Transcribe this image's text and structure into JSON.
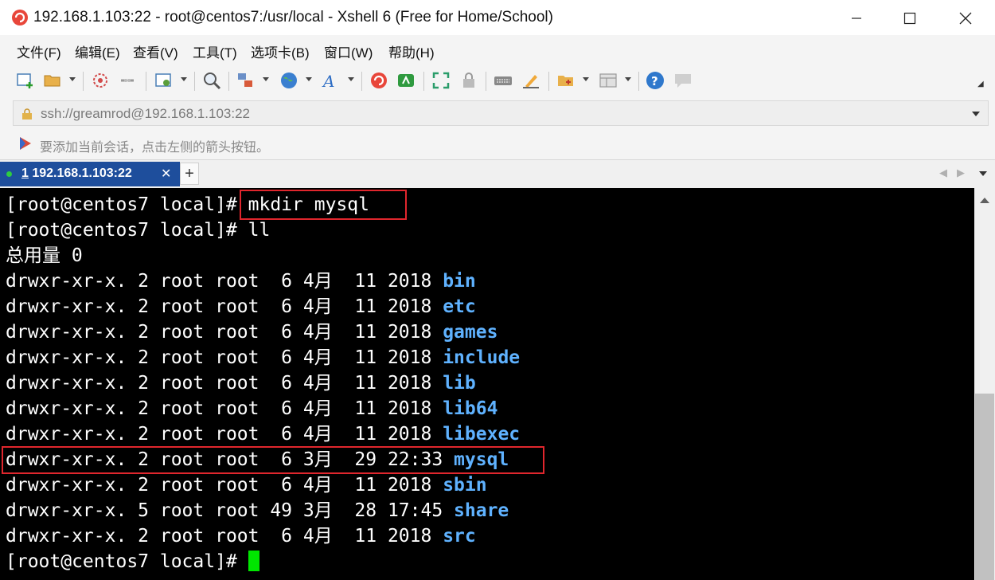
{
  "window": {
    "title": "192.168.1.103:22 - root@centos7:/usr/local - Xshell 6 (Free for Home/School)"
  },
  "menu": [
    "文件(F)",
    "编辑(E)",
    "查看(V)",
    "工具(T)",
    "选项卡(B)",
    "窗口(W)",
    "帮助(H)"
  ],
  "toolbar": {
    "icons": [
      "new-session-icon",
      "open-folder-icon",
      "connect-icon",
      "disconnect-icon",
      "properties-icon",
      "search-icon",
      "transfer-icon",
      "globe-icon",
      "font-icon",
      "xshell-icon",
      "xftp-icon",
      "fullscreen-icon",
      "lock-icon",
      "keyboard-icon",
      "highlight-icon",
      "new-folder-icon",
      "layout-icon",
      "help-icon",
      "chat-icon"
    ]
  },
  "address": {
    "url": "ssh://greamrod@192.168.1.103:22"
  },
  "hint": {
    "text": "要添加当前会话，点击左侧的箭头按钮。"
  },
  "tab": {
    "number": "1",
    "label": "192.168.1.103:22"
  },
  "terminal": {
    "lines": [
      {
        "prefix": "[root@centos7 local]# ",
        "name": "",
        "suffix": "mkdir mysql"
      },
      {
        "prefix": "[root@centos7 local]# ",
        "name": "",
        "suffix": "ll"
      },
      {
        "prefix": "总用量 0",
        "name": "",
        "suffix": ""
      },
      {
        "prefix": "drwxr-xr-x. 2 root root  6 4月  11 2018 ",
        "name": "bin",
        "suffix": ""
      },
      {
        "prefix": "drwxr-xr-x. 2 root root  6 4月  11 2018 ",
        "name": "etc",
        "suffix": ""
      },
      {
        "prefix": "drwxr-xr-x. 2 root root  6 4月  11 2018 ",
        "name": "games",
        "suffix": ""
      },
      {
        "prefix": "drwxr-xr-x. 2 root root  6 4月  11 2018 ",
        "name": "include",
        "suffix": ""
      },
      {
        "prefix": "drwxr-xr-x. 2 root root  6 4月  11 2018 ",
        "name": "lib",
        "suffix": ""
      },
      {
        "prefix": "drwxr-xr-x. 2 root root  6 4月  11 2018 ",
        "name": "lib64",
        "suffix": ""
      },
      {
        "prefix": "drwxr-xr-x. 2 root root  6 4月  11 2018 ",
        "name": "libexec",
        "suffix": ""
      },
      {
        "prefix": "drwxr-xr-x. 2 root root  6 3月  29 22:33 ",
        "name": "mysql",
        "suffix": ""
      },
      {
        "prefix": "drwxr-xr-x. 2 root root  6 4月  11 2018 ",
        "name": "sbin",
        "suffix": ""
      },
      {
        "prefix": "drwxr-xr-x. 5 root root 49 3月  28 17:45 ",
        "name": "share",
        "suffix": ""
      },
      {
        "prefix": "drwxr-xr-x. 2 root root  6 4月  11 2018 ",
        "name": "src",
        "suffix": ""
      },
      {
        "prefix": "[root@centos7 local]# ",
        "name": "",
        "suffix": ""
      }
    ],
    "colors": {
      "background": "#000000",
      "text": "#ffffff",
      "directory": "#5fb2ff",
      "cursor": "#00e600",
      "highlight_box": "#e0262d"
    }
  }
}
